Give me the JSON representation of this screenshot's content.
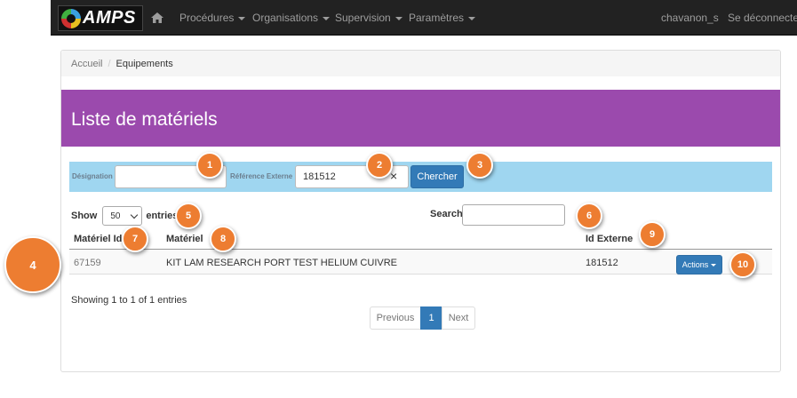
{
  "app": {
    "logo_text": "AMPS"
  },
  "nav": {
    "items": [
      {
        "label": "Procédures"
      },
      {
        "label": "Organisations"
      },
      {
        "label": "Supervision"
      },
      {
        "label": "Paramètres"
      }
    ],
    "user": "chavanon_s",
    "logout": "Se déconnecter",
    "icons": {
      "home": "home-icon",
      "dropdown": "caret-down-icon"
    }
  },
  "breadcrumb": {
    "home": "Accueil",
    "separator": "/",
    "current": "Equipements"
  },
  "page": {
    "title": "Liste de matériels",
    "title_bar_color": "#9b4aad"
  },
  "filters": {
    "designation_label": "Désignation",
    "designation_value": "",
    "ref_label": "Référence Externe",
    "ref_value": "181512",
    "clear_icon": "×",
    "search_button": "Chercher",
    "bar_color": "#9fd6f0"
  },
  "table": {
    "show_label": "Show",
    "page_size": "50",
    "entries_label": "entries",
    "search_label": "Search:",
    "columns": [
      "Matériel Id",
      "Matériel",
      "Id Externe"
    ],
    "rows": [
      {
        "id": "67159",
        "name": "KIT LAM RESEARCH PORT TEST HELIUM CUIVRE",
        "external_id": "181512",
        "actions": "Actions"
      }
    ],
    "info": "Showing 1 to 1 of 1 entries",
    "pagination": {
      "previous": "Previous",
      "current": "1",
      "next": "Next"
    }
  },
  "callouts": [
    "1",
    "2",
    "3",
    "4",
    "5",
    "6",
    "7",
    "8",
    "9",
    "10"
  ],
  "colors": {
    "primary_button": "#337ab7",
    "callout": "#ed7d31",
    "navbar": "#222222"
  }
}
